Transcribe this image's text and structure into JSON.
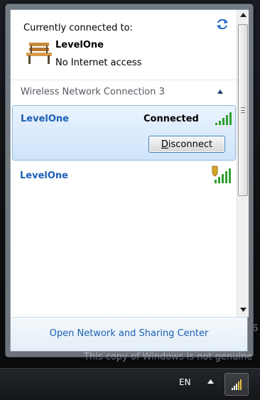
{
  "connected": {
    "title": "Currently connected to:",
    "network_name": "LevelOne",
    "status": "No Internet access"
  },
  "section": {
    "header": "Wireless Network Connection 3"
  },
  "networks": [
    {
      "name": "LevelOne",
      "status": "Connected",
      "button_label_u": "D",
      "button_label_rest": "isconnect",
      "secured": false
    },
    {
      "name": "LevelOne",
      "status": "",
      "secured": true
    }
  ],
  "footer": {
    "link": "Open Network and Sharing Center"
  },
  "desktop": {
    "watermark": "This copy of Windows is not genuine",
    "watermark_fragment": "6"
  },
  "taskbar": {
    "language": "EN"
  },
  "colors": {
    "link": "#1a5fb4",
    "signal": "#2f9e2f",
    "selection": "#cfe4fa"
  },
  "icons": {
    "switch": "refresh-arrows-icon",
    "bench": "park-bench-icon",
    "signal": "signal-bars-icon",
    "shield": "security-shield-icon"
  }
}
